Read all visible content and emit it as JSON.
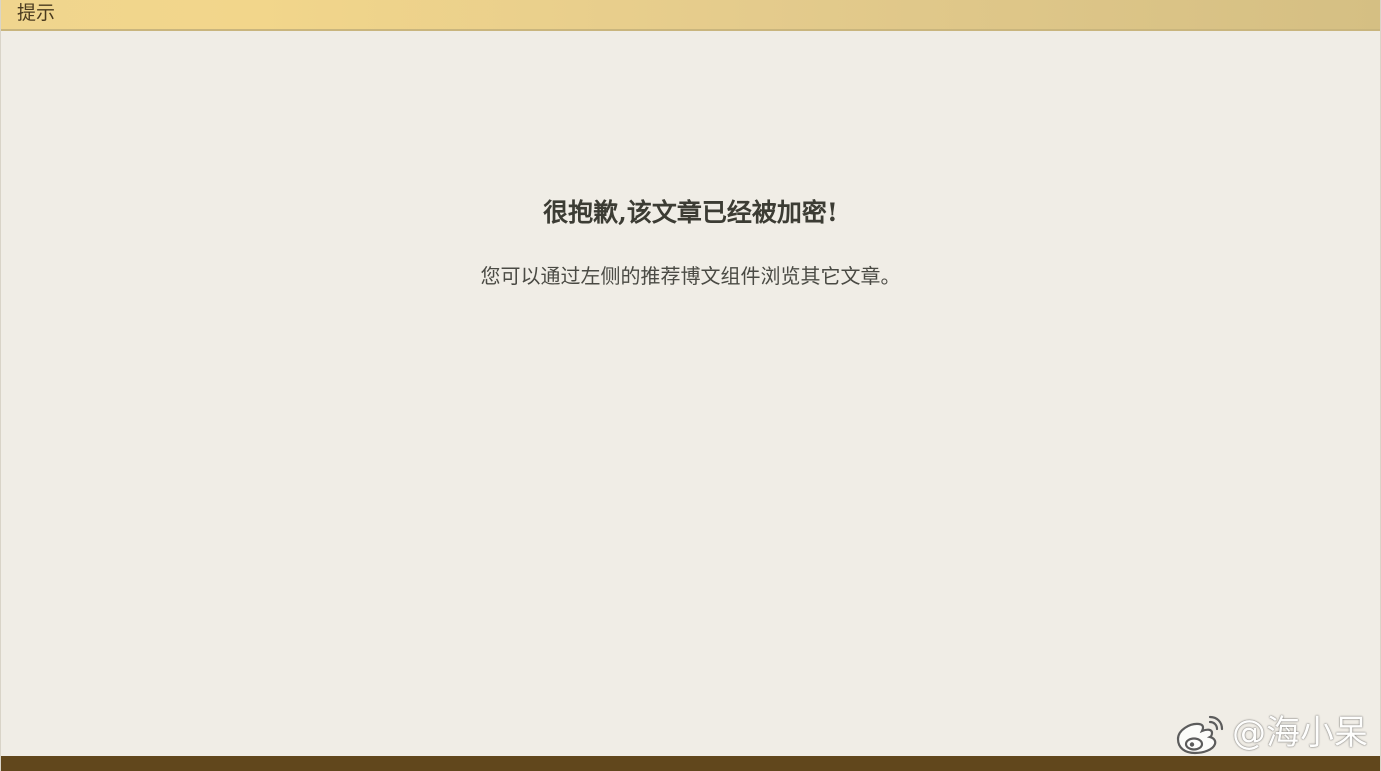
{
  "header": {
    "title": "提示"
  },
  "notice": {
    "title": "很抱歉,该文章已经被加密!",
    "description": "您可以通过左侧的推荐博文组件浏览其它文章。"
  },
  "watermark": {
    "icon": "weibo-icon",
    "text": "@海小呆"
  },
  "colors": {
    "header_gradient_start": "#f0d58e",
    "header_gradient_end": "#d5bf83",
    "background": "#f0ede6",
    "footer_bar": "#61471c",
    "title_text": "#3c3c34"
  }
}
